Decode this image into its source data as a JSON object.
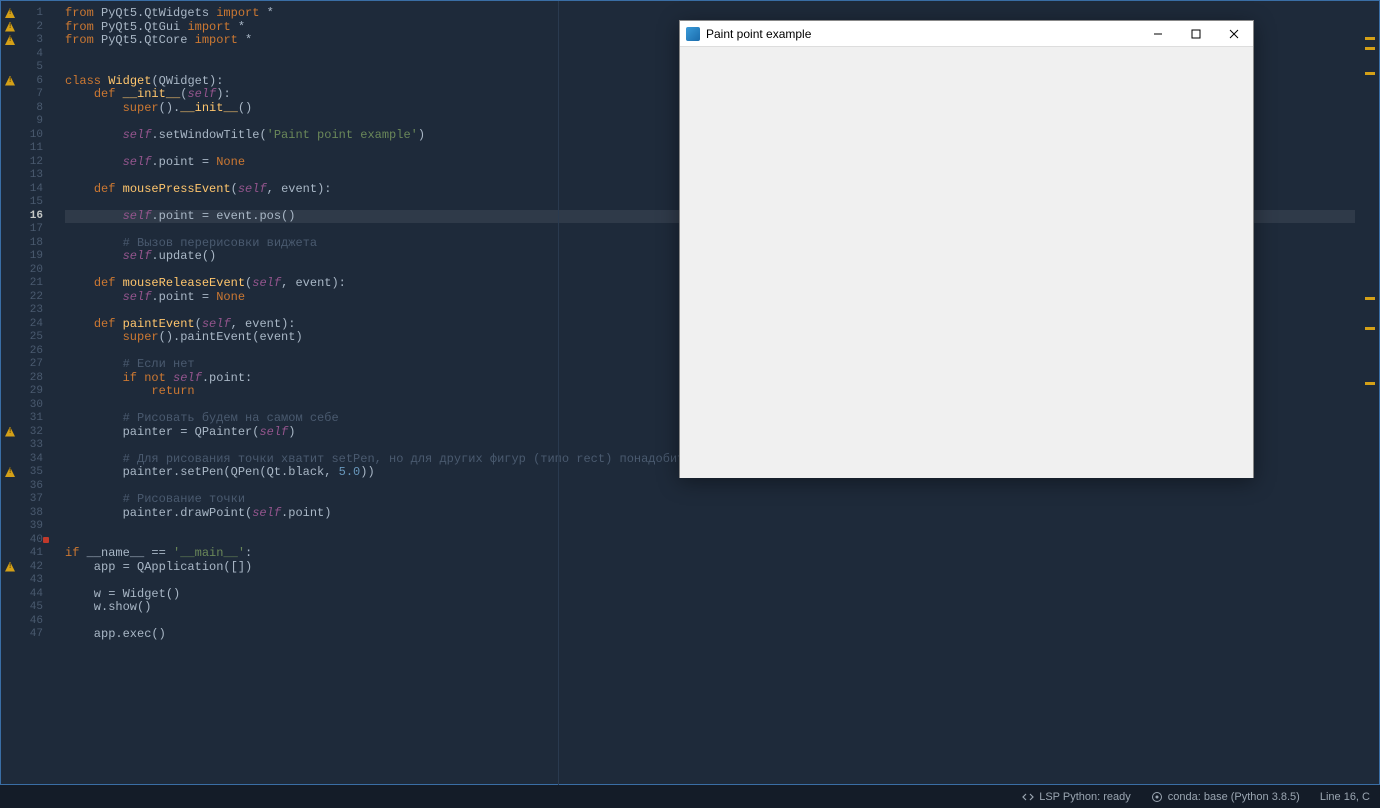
{
  "editor": {
    "active_line": 16,
    "line_count": 47,
    "warnings": [
      1,
      2,
      3,
      6,
      32,
      35,
      42
    ],
    "dot_marker_line": 40,
    "minimap_marks": [
      30,
      40,
      65,
      290,
      320,
      375
    ],
    "code": [
      [
        [
          "kw",
          "from"
        ],
        [
          "plain",
          " PyQt5.QtWidgets "
        ],
        [
          "kw",
          "import"
        ],
        [
          "plain",
          " *"
        ]
      ],
      [
        [
          "kw",
          "from"
        ],
        [
          "plain",
          " PyQt5.QtGui "
        ],
        [
          "kw",
          "import"
        ],
        [
          "plain",
          " *"
        ]
      ],
      [
        [
          "kw",
          "from"
        ],
        [
          "plain",
          " PyQt5.QtCore "
        ],
        [
          "kw",
          "import"
        ],
        [
          "plain",
          " *"
        ]
      ],
      [],
      [],
      [
        [
          "kw",
          "class"
        ],
        [
          "plain",
          " "
        ],
        [
          "fn",
          "Widget"
        ],
        [
          "plain",
          "(QWidget):"
        ]
      ],
      [
        [
          "plain",
          "    "
        ],
        [
          "kw",
          "def"
        ],
        [
          "plain",
          " "
        ],
        [
          "fn",
          "__init__"
        ],
        [
          "plain",
          "("
        ],
        [
          "self",
          "self"
        ],
        [
          "plain",
          "):"
        ]
      ],
      [
        [
          "plain",
          "        "
        ],
        [
          "kw",
          "super"
        ],
        [
          "plain",
          "()."
        ],
        [
          "fn",
          "__init__"
        ],
        [
          "plain",
          "()"
        ]
      ],
      [],
      [
        [
          "plain",
          "        "
        ],
        [
          "self",
          "self"
        ],
        [
          "plain",
          ".setWindowTitle("
        ],
        [
          "str",
          "'Paint point example'"
        ],
        [
          "plain",
          ")"
        ]
      ],
      [],
      [
        [
          "plain",
          "        "
        ],
        [
          "self",
          "self"
        ],
        [
          "plain",
          ".point = "
        ],
        [
          "none",
          "None"
        ]
      ],
      [],
      [
        [
          "plain",
          "    "
        ],
        [
          "kw",
          "def"
        ],
        [
          "plain",
          " "
        ],
        [
          "fn",
          "mousePressEvent"
        ],
        [
          "plain",
          "("
        ],
        [
          "self",
          "self"
        ],
        [
          "plain",
          ", event):"
        ]
      ],
      [],
      [
        [
          "plain",
          "        "
        ],
        [
          "self",
          "self"
        ],
        [
          "plain",
          ".point = event.pos()"
        ]
      ],
      [],
      [
        [
          "plain",
          "        "
        ],
        [
          "cmt",
          "# Вызов перерисовки виджета"
        ]
      ],
      [
        [
          "plain",
          "        "
        ],
        [
          "self",
          "self"
        ],
        [
          "plain",
          ".update()"
        ]
      ],
      [],
      [
        [
          "plain",
          "    "
        ],
        [
          "kw",
          "def"
        ],
        [
          "plain",
          " "
        ],
        [
          "fn",
          "mouseReleaseEvent"
        ],
        [
          "plain",
          "("
        ],
        [
          "self",
          "self"
        ],
        [
          "plain",
          ", event):"
        ]
      ],
      [
        [
          "plain",
          "        "
        ],
        [
          "self",
          "self"
        ],
        [
          "plain",
          ".point = "
        ],
        [
          "none",
          "None"
        ]
      ],
      [],
      [
        [
          "plain",
          "    "
        ],
        [
          "kw",
          "def"
        ],
        [
          "plain",
          " "
        ],
        [
          "fn",
          "paintEvent"
        ],
        [
          "plain",
          "("
        ],
        [
          "self",
          "self"
        ],
        [
          "plain",
          ", event):"
        ]
      ],
      [
        [
          "plain",
          "        "
        ],
        [
          "kw",
          "super"
        ],
        [
          "plain",
          "().paintEvent(event)"
        ]
      ],
      [],
      [
        [
          "plain",
          "        "
        ],
        [
          "cmt",
          "# Если нет"
        ]
      ],
      [
        [
          "plain",
          "        "
        ],
        [
          "kw",
          "if"
        ],
        [
          "plain",
          " "
        ],
        [
          "kw",
          "not"
        ],
        [
          "plain",
          " "
        ],
        [
          "self",
          "self"
        ],
        [
          "plain",
          ".point:"
        ]
      ],
      [
        [
          "plain",
          "            "
        ],
        [
          "kw",
          "return"
        ]
      ],
      [],
      [
        [
          "plain",
          "        "
        ],
        [
          "cmt",
          "# Рисовать будем на самом себе"
        ]
      ],
      [
        [
          "plain",
          "        painter = QPainter("
        ],
        [
          "self",
          "self"
        ],
        [
          "plain",
          ")"
        ]
      ],
      [],
      [
        [
          "plain",
          "        "
        ],
        [
          "cmt",
          "# Для рисования точки хватит setPen, но для других фигур (типо rect) понадобится setBrush"
        ]
      ],
      [
        [
          "plain",
          "        painter.setPen(QPen(Qt.black, "
        ],
        [
          "num",
          "5.0"
        ],
        [
          "plain",
          "))"
        ]
      ],
      [],
      [
        [
          "plain",
          "        "
        ],
        [
          "cmt",
          "# Рисование точки"
        ]
      ],
      [
        [
          "plain",
          "        painter.drawPoint("
        ],
        [
          "self",
          "self"
        ],
        [
          "plain",
          ".point)"
        ]
      ],
      [],
      [],
      [
        [
          "kw",
          "if"
        ],
        [
          "plain",
          " __name__ == "
        ],
        [
          "str",
          "'__main__'"
        ],
        [
          "plain",
          ":"
        ]
      ],
      [
        [
          "plain",
          "    app = QApplication([])"
        ]
      ],
      [],
      [
        [
          "plain",
          "    w = Widget()"
        ]
      ],
      [
        [
          "plain",
          "    w.show()"
        ]
      ],
      [],
      [
        [
          "plain",
          "    app.exec()"
        ]
      ]
    ]
  },
  "app_window": {
    "title": "Paint point example"
  },
  "status": {
    "lsp": "LSP Python: ready",
    "conda": "conda: base (Python 3.8.5)",
    "position": "Line 16, C"
  }
}
